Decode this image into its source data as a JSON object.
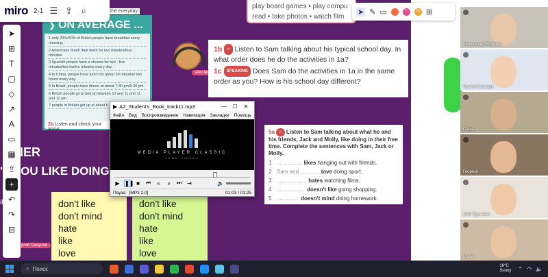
{
  "miro": {
    "logo": "miro",
    "page": "2-1",
    "icons": {
      "menu": "menu-icon",
      "share": "upload-icon",
      "search": "search-icon"
    }
  },
  "toolbar": {
    "tools": [
      {
        "name": "select-tool",
        "glyph": "➤"
      },
      {
        "name": "frame-tool",
        "glyph": "⊞"
      },
      {
        "name": "text-tool",
        "glyph": "T"
      },
      {
        "name": "sticky-note-tool",
        "glyph": "▢"
      },
      {
        "name": "shapes-tool",
        "glyph": "◇"
      },
      {
        "name": "connector-tool",
        "glyph": "↗"
      },
      {
        "name": "pen-tool",
        "glyph": "A"
      },
      {
        "name": "comment-tool",
        "glyph": "▭"
      },
      {
        "name": "table-tool",
        "glyph": "▦"
      },
      {
        "name": "upload-tool",
        "glyph": "⇪"
      },
      {
        "name": "add-tool",
        "glyph": "+"
      },
      {
        "name": "undo-tool",
        "glyph": "↶"
      },
      {
        "name": "redo-tool",
        "glyph": "↷"
      },
      {
        "name": "frames-panel-tool",
        "glyph": "⊟"
      }
    ]
  },
  "board": {
    "top_snippet": "the everyday",
    "avg_title": "ON AVERAGE ...",
    "avg_items": [
      "only 20%/50% of British people have breakfast every morning.",
      "Americans brush their teeth for two minutes/four minutes.",
      "Spanish people have a shower for two - five minutes/ten-twelve minutes every day.",
      "In China, people have lunch for about 30 minutes/ two hours every day.",
      "In Brazil, people have dinner at about 7:30 pm/9.30 pm.",
      "British people go to bed at between 10 and 11 pm/ 11 and 12 pm.",
      "people in Britain get up at about 6..."
    ],
    "check_line_num": "2b",
    "check_line_text": "Listen and check your answ",
    "activities": [
      "play board games  •  play compu",
      "read  •  take photos  •  watch film"
    ],
    "ex1b_num": "1b",
    "ex1b_text": "Listen to Sam talking about his typical school day. In what order does he do the activities in 1a?",
    "ex1c_num": "1c",
    "speaking_badge": "SPEAKING",
    "ex1c_text": "Does Sam do the activities in 1a in the same order as you? How is his school day different?",
    "ex5_num": "5a",
    "ex5_instr": "Listen to Sam talking about what he and his friends, Jack and Molly, like doing in their free time. Complete the sentences with Sam, Jack or Molly.",
    "ex5_rows": [
      {
        "n": "1",
        "dots": "................",
        "text": "likes hanging out with friends."
      },
      {
        "n": "2",
        "dots": "Sam and ............",
        "text": "love doing sport."
      },
      {
        "n": "3",
        "dots": "...................",
        "text": "hates watching films."
      },
      {
        "n": "4",
        "dots": "..................",
        "text": "doesn't like going shopping."
      },
      {
        "n": "5",
        "dots": "..............",
        "text": "doesn't mind doing homework."
      }
    ],
    "partner": "TNER",
    "question": "'T YOU LIKE DOING?",
    "like_label": "ike",
    "sticky_yellow": [
      "don't like",
      "don't mind",
      "hate",
      "like",
      "love"
    ],
    "sticky_green": [
      "don't like",
      "don't mind",
      "hate",
      "like",
      "love"
    ],
    "cursor_tag": "alex leventshyn",
    "bottom_tag": "ргий Сапунов"
  },
  "player": {
    "title": "A2_Student's_Book_track11.mp3",
    "menu": [
      "Файл",
      "Вид",
      "Воспроизведение",
      "Навигация",
      "Закладки",
      "Помощь"
    ],
    "screen_name": "MEDIA PLAYER CLASSIC",
    "screen_sub": "HOME CINEMA",
    "status": "Пауза",
    "format": "[MP3 2.0]",
    "time": "01:03 / 01:25",
    "progress": 0.74
  },
  "right_tools": {
    "avatars": [
      {
        "letter": "",
        "color": "#ff6a3d"
      },
      {
        "letter": "Г",
        "color": "#e54c88"
      },
      {
        "letter": "М",
        "color": "#f0a22c"
      }
    ]
  },
  "participants": [
    {
      "name": "Мирослава Елагина",
      "bg": "#c8c2b8",
      "face": "#e8c6a8"
    },
    {
      "name": "Мария Калашук",
      "bg": "#dfe6ef",
      "face": "#f2cfb0"
    },
    {
      "name": "Саша",
      "bg": "#b5a98f",
      "face": "#d6b08c"
    },
    {
      "name": "Георгий",
      "bg": "#8a7560",
      "face": "#e3b893"
    },
    {
      "name": "Катя Грузнова",
      "bg": "#e9e3dc",
      "face": "#f0c9a9"
    },
    {
      "name": "Maria",
      "bg": "#cdbba5",
      "face": "#e9c4a2"
    }
  ],
  "taskbar": {
    "search_placeholder": "Поиск",
    "apps": [
      "#e55b2b",
      "#3a6fd8",
      "#5b5bd6",
      "#f5c842",
      "#2db54d",
      "#e2492d",
      "#1e90ff",
      "#58c4e8",
      "#4a4a8a"
    ],
    "weather_temp": "16°C",
    "weather_desc": "Sunny"
  }
}
